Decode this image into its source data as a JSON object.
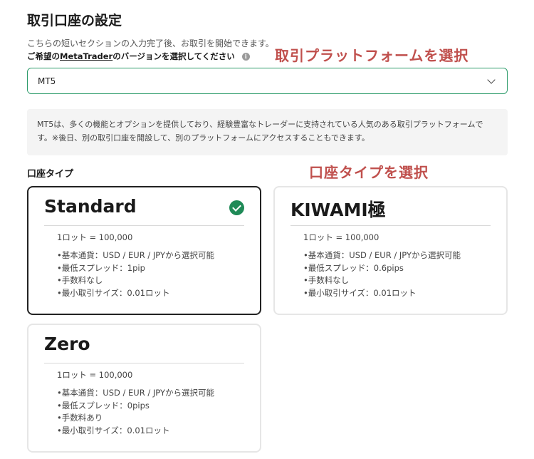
{
  "header": {
    "title": "取引口座の設定",
    "intro": "こちらの短いセクションの入力完了後、お取引を開始できます。",
    "version_prefix": "ご希望の",
    "version_link": "MetaTrader",
    "version_suffix": "のバージョンを選択してください",
    "info_icon_glyph": "i"
  },
  "annotations": {
    "platform": "取引プラットフォームを選択",
    "account_type": "口座タイプを選択"
  },
  "platform": {
    "selected": "MT5",
    "description": "MT5は、多くの機能とオプションを提供しており、経験豊富なトレーダーに支持されている人気のある取引プラットフォームです。※後日、別の取引口座を開設して、別のプラットフォームにアクセスすることもできます。"
  },
  "account_types": {
    "label": "口座タイプ",
    "cards": [
      {
        "name": "Standard",
        "selected": true,
        "lot": "1ロット = 100,000",
        "features": [
          "•基本通貨：USD / EUR / JPYから選択可能",
          "•最低スプレッド：1pip",
          "•手数料なし",
          "•最小取引サイズ：0.01ロット"
        ]
      },
      {
        "name": "KIWAMI極",
        "selected": false,
        "lot": "1ロット = 100,000",
        "features": [
          "•基本通貨：USD / EUR / JPYから選択可能",
          "•最低スプレッド：0.6pips",
          "•手数料なし",
          "•最小取引サイズ：0.01ロット"
        ]
      },
      {
        "name": "Zero",
        "selected": false,
        "lot": "1ロット = 100,000",
        "features": [
          "•基本通貨：USD / EUR / JPYから選択可能",
          "•最低スプレッド：0pips",
          "•手数料あり",
          "•最小取引サイズ：0.01ロット"
        ]
      }
    ]
  },
  "colors": {
    "accent_green": "#1f8a57",
    "select_border": "#2e9c6b",
    "annotation_red": "#c0504d"
  }
}
